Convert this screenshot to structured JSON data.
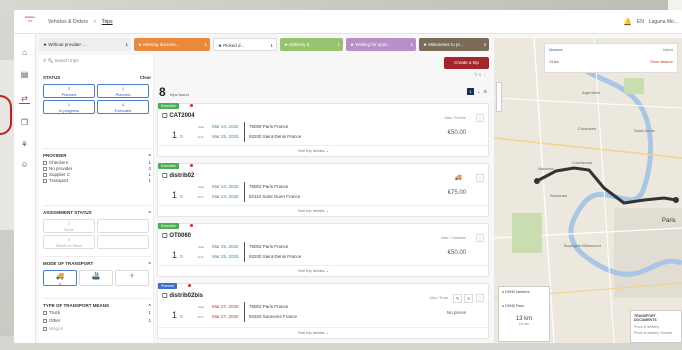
{
  "app": {
    "logo_text": "Carrier",
    "breadcrumb": [
      "Vehicles & Orders",
      "Trips"
    ],
    "topright": {
      "lang": "EN",
      "user": "Laguna Mo..."
    }
  },
  "tags": [
    {
      "label": "Without provider ...",
      "count": "1"
    },
    {
      "label": "Missing docume...",
      "count": "1"
    },
    {
      "label": "Picked d...",
      "count": "1"
    },
    {
      "label": "Delivery d...",
      "count": "1"
    },
    {
      "label": "Waiting for quot...",
      "count": "1"
    },
    {
      "label": "Milestones to pr...",
      "count": "4"
    }
  ],
  "filters": {
    "search_placeholder": "Search trips",
    "status": {
      "title": "STATUS",
      "action": "Clear",
      "boxes": [
        {
          "count": "2",
          "label": "Planned"
        },
        {
          "count": "1",
          "label": "Planned"
        },
        {
          "count": "1",
          "label": "In progress"
        },
        {
          "count": "4",
          "label": "Executed"
        }
      ]
    },
    "providers": {
      "title": "PROVIDER",
      "items": [
        {
          "label": "Checkers",
          "count": "1"
        },
        {
          "label": "No provider",
          "count": "3"
        },
        {
          "label": "Supplier C",
          "count": "1"
        },
        {
          "label": "Transport",
          "count": "1"
        }
      ]
    },
    "assignment": {
      "title": "ASSIGNMENT STATUS",
      "boxes": [
        {
          "count": "2",
          "label": "Done"
        },
        {
          "count": "",
          "label": ""
        },
        {
          "count": "3",
          "label": "Needs to fillout"
        },
        {
          "count": "",
          "label": ""
        }
      ]
    },
    "transport_mode": {
      "title": "MODE OF TRANSPORT",
      "modes": [
        "🚚",
        "🚢",
        "✈"
      ],
      "mode_counts": [
        "4",
        "",
        ""
      ]
    },
    "transport_means": {
      "title": "TYPE OF TRANSPORT MEANS",
      "items": [
        {
          "label": "Truck",
          "count": "1"
        },
        {
          "label": "Other",
          "count": "1"
        },
        {
          "label": "Wagon",
          "count": ""
        }
      ]
    }
  },
  "trips": {
    "count": "8",
    "count_label": "trips found",
    "create_label": "Create a trip",
    "cards": [
      {
        "status": "Executed",
        "id": "CAT2004",
        "qty": "1",
        "start": "Mar 24, 2025",
        "end": "Mar 25, 2025",
        "from": "75008 Paris France",
        "to": "93200 Saint-Denis France",
        "price": "€50.00",
        "note": "Aldo / Trevion",
        "date_color": "green",
        "badge_color": "green"
      },
      {
        "status": "Executed",
        "id": "distrib02",
        "qty": "1",
        "start": "Mar 24, 2025",
        "end": "Mar 24, 2025",
        "from": "75003 Paris France",
        "to": "92110 Saint Ouen France",
        "price": "€75.00",
        "note": "Truck",
        "date_color": "green",
        "badge_color": "green"
      },
      {
        "status": "Executed",
        "id": "OT0060",
        "qty": "1",
        "start": "Mar 25, 2025",
        "end": "Mar 25, 2025",
        "from": "75003 Paris France",
        "to": "93200 Saint-Denis France",
        "price": "€50.00",
        "note": "Aldo / Checkers",
        "date_color": "green",
        "badge_color": "green"
      },
      {
        "status": "Planned",
        "id": "distrib02bis",
        "qty": "1",
        "start": "Mar 27, 2025",
        "end": "Mar 27, 2025",
        "from": "75003 Paris France",
        "to": "94320 Suresnes France",
        "price": "No prices",
        "note": "Aldo / Truck",
        "date_color": "red",
        "badge_color": "blue"
      }
    ],
    "see_details": "See trip details"
  },
  "map": {
    "labels": [
      "Argenteuil",
      "Nanterre",
      "Courbevoie",
      "Suresnes",
      "Paris",
      "Colombes",
      "Boulogne-Billancourt",
      "Saint-Denis"
    ],
    "info": {
      "title": "Distance",
      "badge": "Hybrid",
      "value": "13 km",
      "sub": "Show distance"
    },
    "route_card": {
      "stop1": "DSHD Nanterre",
      "stop2": "DSHD Paris",
      "distance": "13 km",
      "duration": "16 min"
    },
    "bottom": {
      "title": "TRANSPORT DOCUMENTS",
      "line1": "Proof of delivery",
      "line2": "Proof of delivery Number"
    }
  }
}
